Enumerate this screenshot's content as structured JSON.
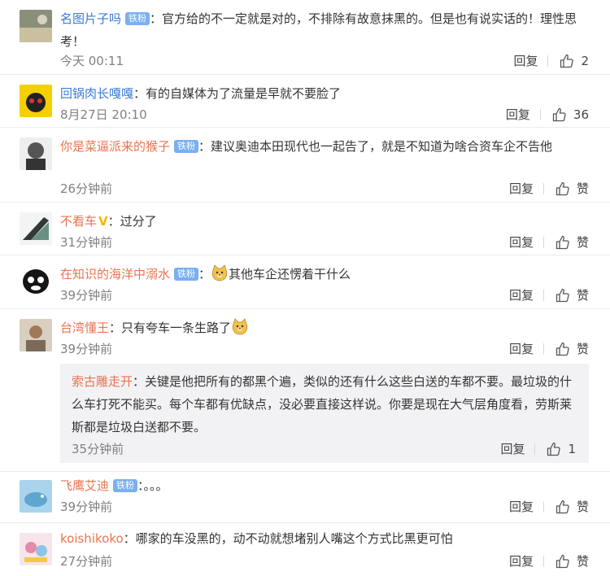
{
  "comments": [
    {
      "user": "名图片子吗",
      "badge": "铁粉",
      "sep": "：",
      "text": "官方给的不一定就是对的，不排除有故意抹黑的。但是也有说实话的！理性思考！",
      "time": "今天 00:11",
      "reply": "回复",
      "likes": "2"
    },
    {
      "user": "回锅肉长嘎嘎",
      "badge": "",
      "sep": "：",
      "text": "有的自媒体为了流量是早就不要脸了",
      "time": "8月27日 20:10",
      "reply": "回复",
      "likes": "36"
    },
    {
      "user": "你是菜逼派来的猴子",
      "badge": "铁粉",
      "sep": "：",
      "text": "建议奥迪本田现代也一起告了，就是不知道为啥合资车企不告他",
      "time": "26分钟前",
      "reply": "回复",
      "likes": "赞"
    },
    {
      "user": "不看车",
      "badge": "V",
      "sep": "：",
      "text": "过分了",
      "time": "31分钟前",
      "reply": "回复",
      "likes": "赞"
    },
    {
      "user": "在知识的海洋中溺水",
      "badge": "铁粉",
      "sep": "：",
      "text": "其他车企还愣着干什么",
      "time": "39分钟前",
      "reply": "回复",
      "likes": "赞"
    },
    {
      "user": "台湾懂王",
      "badge": "",
      "sep": "：",
      "text": "只有夸车一条生路了",
      "time": "39分钟前",
      "reply": "回复",
      "likes": "赞"
    },
    {
      "user": "飞鹰艾迪",
      "badge": "铁粉",
      "sep": "：",
      "text": "。。。",
      "time": "39分钟前",
      "reply": "回复",
      "likes": "赞"
    },
    {
      "user": "koishikoko",
      "badge": "",
      "sep": "：",
      "text": "哪家的车没黑的，动不动就想堵别人嘴这个方式比黑更可怕",
      "time": "27分钟前",
      "reply": "回复",
      "likes": "赞"
    }
  ],
  "nested_reply": {
    "user": "索古雕走开",
    "sep": "：",
    "text": "关键是他把所有的都黑个遍，类似的还有什么这些白送的车都不要。最垃圾的什么车打死不能买。每个车都有优缺点，没必要直接这样说。你要是现在大气层角度看，劳斯莱斯都是垃圾白送都不要。",
    "time": "35分钟前",
    "reply": "回复",
    "likes": "1"
  },
  "colors": {
    "username": "#eb7350",
    "username_blue": "#3a7bd5",
    "badge": "#7aaff0",
    "time": "#808080"
  }
}
